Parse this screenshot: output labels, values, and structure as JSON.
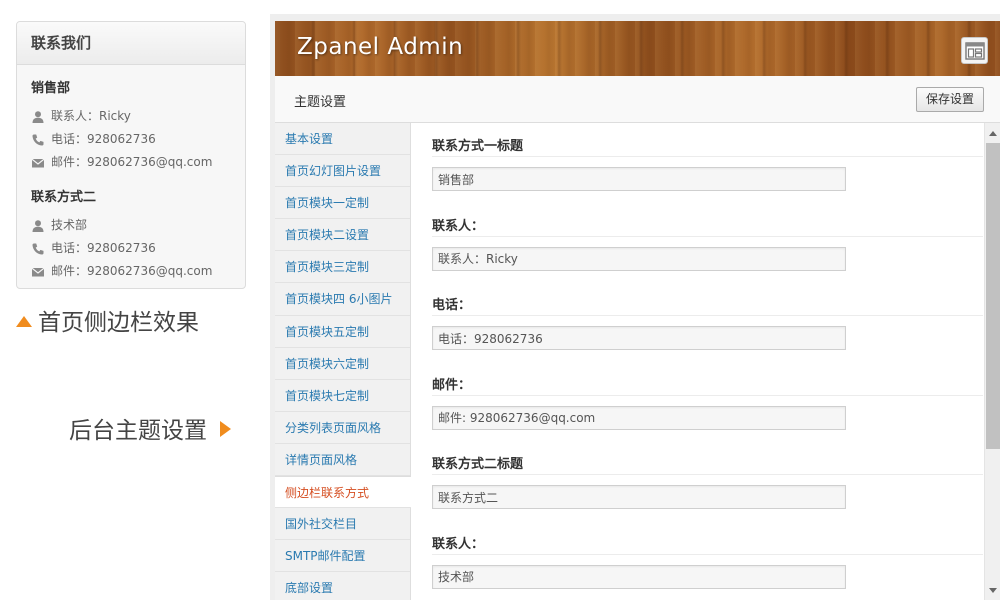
{
  "contact_widget": {
    "title": "联系我们",
    "sections": [
      {
        "title": "销售部",
        "contact_label": "联系人：Ricky",
        "phone": "电话：928062736",
        "email": "邮件：928062736@qq.com"
      },
      {
        "title": "联系方式二",
        "contact_label": "技术部",
        "phone": "电话：928062736",
        "email": "邮件：928062736@qq.com"
      }
    ],
    "icons": [
      "user-icon",
      "phone-icon",
      "mail-icon"
    ]
  },
  "captions": {
    "sidebar_effect": "首页侧边栏效果",
    "admin_settings": "后台主题设置",
    "accent_color": "#f08c1e"
  },
  "admin": {
    "brand": "Zpanel  Admin",
    "layout_icon": "layout-icon",
    "subheader_title": "主题设置",
    "save_label": "保存设置",
    "nav_items": [
      "基本设置",
      "首页幻灯图片设置",
      "首页模块一定制",
      "首页模块二设置",
      "首页模块三定制",
      "首页模块四 6小图片",
      "首页模块五定制",
      "首页模块六定制",
      "首页模块七定制",
      "分类列表页面风格",
      "详情页面风格",
      "侧边栏联系方式",
      "国外社交栏目",
      "SMTP邮件配置",
      "底部设置"
    ],
    "active_nav_index": 11,
    "fields": [
      {
        "label": "联系方式一标题",
        "value": "销售部"
      },
      {
        "label": "联系人：",
        "value": "联系人：Ricky"
      },
      {
        "label": "电话：",
        "value": "电话：928062736"
      },
      {
        "label": "邮件：",
        "value": "邮件: 928062736@qq.com"
      },
      {
        "label": "联系方式二标题",
        "value": "联系方式二"
      },
      {
        "label": "联系人：",
        "value": "技术部"
      }
    ],
    "colors": {
      "link": "#2a7ab0",
      "active_link": "#d54e21"
    }
  }
}
